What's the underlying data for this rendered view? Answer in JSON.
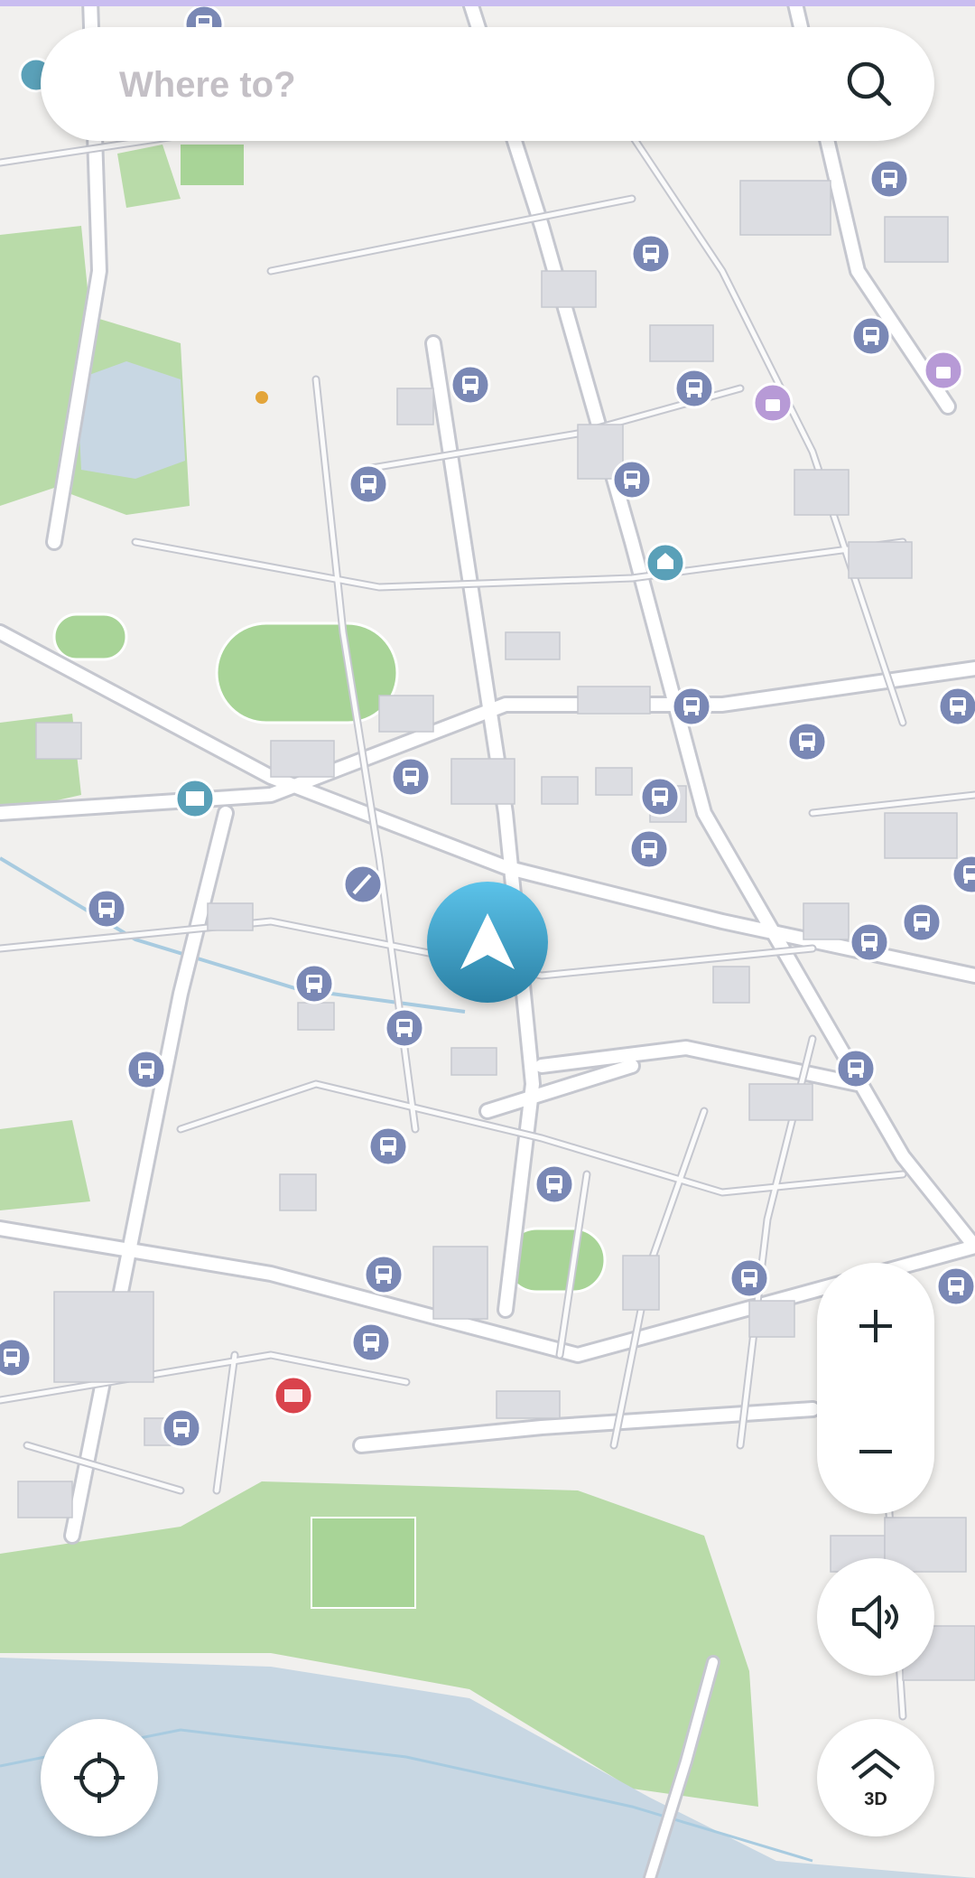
{
  "search": {
    "placeholder": "Where to?"
  },
  "icons": {
    "search": "search-icon",
    "locate": "crosshair-icon",
    "zoom_in": "plus-icon",
    "zoom_out": "minus-icon",
    "sound": "speaker-icon",
    "view": "3d-view-icon",
    "position": "navigation-arrow-icon"
  },
  "view_button": {
    "label": "3D"
  },
  "colors": {
    "bus_stop": "#7a88b5",
    "park": "#b9dba9",
    "water": "#c8d7e3",
    "position_marker": "#3f9fc8",
    "top_bar": "#c9bdf0"
  }
}
